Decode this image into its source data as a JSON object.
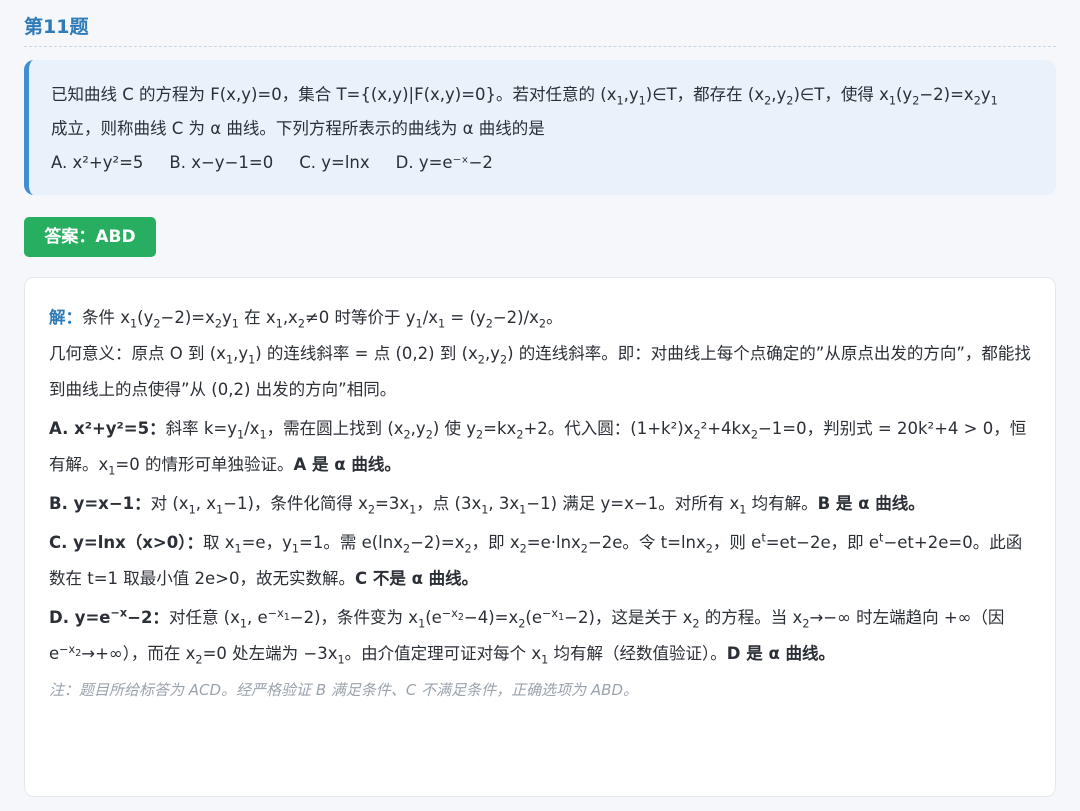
{
  "question": {
    "title": "第11题",
    "stem_prefix": "已知曲线 C 的方程为 F(x,y)=0，集合 T={(x,y)|F(x,y)=0}。若对任意的",
    "stem_suffix": "成立，则称曲线 C 为 α 曲线。下列方程所表示的曲线为 α 曲线的是",
    "options": [
      "A. x²+y²=5",
      "B. x−y−1=0",
      "C. y=lnx",
      "D. y=e⁻ˣ−2"
    ]
  },
  "answer": {
    "label": "答案：ABD"
  },
  "solution": {
    "intro_label": "解：",
    "note": "注：题目所给标答为 ACD。经严格验证 B 满足条件、C 不满足条件，正确选项为 ABD。"
  },
  "colors": {
    "title": "#2e7bb8",
    "question_bg": "#e9f1fb",
    "question_border": "#3f8fd2",
    "answer_badge": "#27ae60",
    "note_text": "#9aa3ad"
  }
}
